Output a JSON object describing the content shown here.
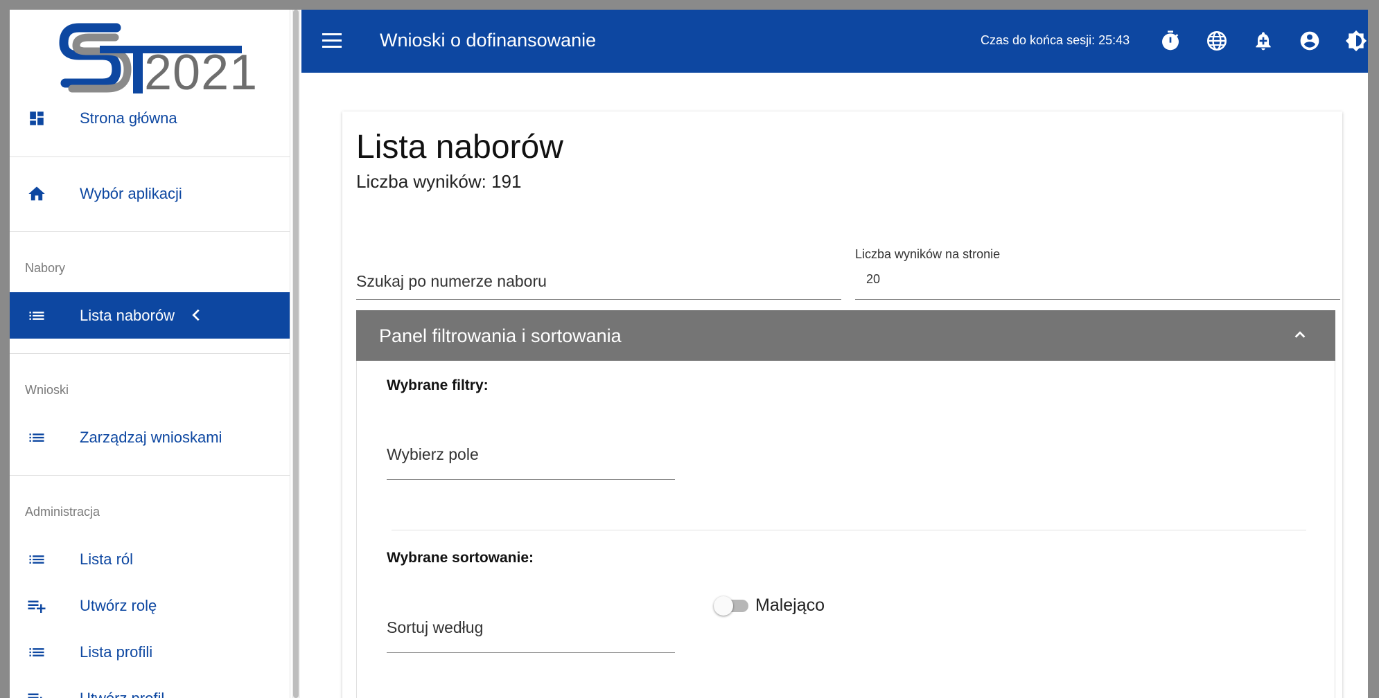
{
  "logo": {
    "year": "2021"
  },
  "sidebar": {
    "items": [
      {
        "label": "Strona główna",
        "icon": "dashboard-icon"
      },
      {
        "label": "Wybór aplikacji",
        "icon": "home-icon"
      },
      {
        "label": "Lista naborów",
        "icon": "list-icon",
        "active": true
      },
      {
        "label": "Zarządzaj wnioskami",
        "icon": "list-icon"
      },
      {
        "label": "Lista ról",
        "icon": "list-icon"
      },
      {
        "label": "Utwórz rolę",
        "icon": "playlist-add-icon"
      },
      {
        "label": "Lista profili",
        "icon": "list-icon"
      },
      {
        "label": "Utwórz profil",
        "icon": "playlist-add-icon"
      }
    ],
    "sections": {
      "nabory": "Nabory",
      "wnioski": "Wnioski",
      "administracja": "Administracja"
    }
  },
  "topbar": {
    "title": "Wnioski o dofinansowanie",
    "session": "Czas do końca sesji: 25:43",
    "icons": [
      "timer-icon",
      "globe-icon",
      "notification-bell-icon",
      "account-icon",
      "contrast-icon"
    ]
  },
  "main": {
    "title": "Lista naborów",
    "result_count": "Liczba wyników: 191",
    "search_placeholder": "Szukaj po numerze naboru",
    "per_page_label": "Liczba wyników na stronie",
    "per_page_value": "20",
    "panel": {
      "title": "Panel filtrowania i sortowania",
      "filters_label": "Wybrane filtry:",
      "field_select_placeholder": "Wybierz pole",
      "sorting_label": "Wybrane sortowanie:",
      "sort_by_placeholder": "Sortuj według",
      "descending_label": "Malejąco",
      "descending_on": false
    }
  },
  "colors": {
    "primary": "#0d47a1",
    "panel_header": "#757575"
  }
}
